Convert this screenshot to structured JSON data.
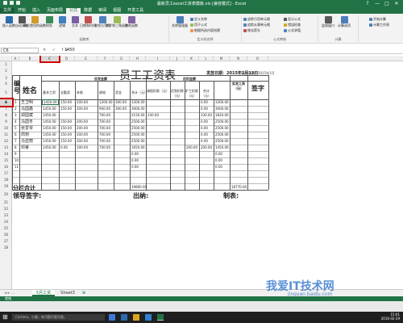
{
  "app": {
    "title": "最新员工excel工资表模板.xls [兼容模式] - Excel",
    "window_controls": [
      "?",
      "—",
      "□",
      "✕"
    ]
  },
  "tabs": [
    "文件",
    "开始",
    "插入",
    "页面布局",
    "公式",
    "数据",
    "审阅",
    "视图",
    "开发工具"
  ],
  "active_tab": "公式",
  "ribbon": {
    "buttons": [
      {
        "icon": "fx-icon",
        "label": "插入函数",
        "color": "#2b6cb0"
      },
      {
        "icon": "autosum-icon",
        "label": "自动求和",
        "color": "#555555"
      },
      {
        "icon": "recent-icon",
        "label": "最近使用的函数",
        "color": "#d39b2b"
      },
      {
        "icon": "finance-icon",
        "label": "财务",
        "color": "#3a8a5a"
      },
      {
        "icon": "logic-icon",
        "label": "逻辑",
        "color": "#3f7fc4"
      },
      {
        "icon": "text-icon",
        "label": "文本",
        "color": "#7b5ea7"
      },
      {
        "icon": "datetime-icon",
        "label": "日期和时间",
        "color": "#c0504d"
      },
      {
        "icon": "lookup-icon",
        "label": "查找与引用",
        "color": "#4f81bd"
      },
      {
        "icon": "math-icon",
        "label": "数学和三角函数",
        "color": "#9bbb59"
      },
      {
        "icon": "more-icon",
        "label": "其他函数",
        "color": "#8064a2"
      },
      {
        "icon": "name-manager-icon",
        "label": "名称管理器",
        "color": "#4a7ebb"
      },
      {
        "icon": "watch-icon",
        "label": "监视窗口",
        "color": "#5a5a5a"
      },
      {
        "icon": "calc-options-icon",
        "label": "计算选项",
        "color": "#4a7ebb"
      }
    ],
    "small": [
      "定义名称",
      "用于公式",
      "根据所选内容创建",
      "追踪引用单元格",
      "追踪从属单元格",
      "移去箭头",
      "显示公式",
      "错误检查",
      "公式求值",
      "开始计算",
      "计算工作表"
    ],
    "groups": [
      "函数库",
      "定义的名称",
      "公式审核",
      "计算"
    ]
  },
  "formula_bar": {
    "name_box": "C6",
    "fx": "✕  ✓  fx",
    "value": "1450"
  },
  "columns": [
    "A",
    "B",
    "C",
    "D",
    "E",
    "F",
    "G",
    "H",
    "I",
    "J",
    "K",
    "L",
    "M",
    "N",
    "O"
  ],
  "rows": [
    "1",
    "2",
    "3",
    "4",
    "5",
    "6",
    "7",
    "8",
    "9",
    "10",
    "11",
    "12",
    "13",
    "14",
    "15",
    "16",
    "17",
    "18",
    "19",
    "20",
    "21",
    "22",
    "23",
    "24",
    "25",
    "26",
    "27",
    "28"
  ],
  "sheet": {
    "title": "员工工资表",
    "issue_date": "发放日期：2015年2月12日",
    "period": "所属日期：2015年1月",
    "header_no": "编号",
    "header_name": "姓名",
    "header_payable": "应发金额",
    "header_deduct": "应扣金额",
    "header_actual": "实发工资（元）",
    "header_sign": "签字",
    "sub_payable": [
      "基本工资",
      "全勤奖",
      "补助",
      "绩效",
      "奖金",
      "合计（元）"
    ],
    "sub_deduct": [
      "请假扣款（元）",
      "迟到扣款（元）",
      "旷工扣款（元）",
      "合计（元）"
    ],
    "rows": [
      {
        "no": "1",
        "name": "王卫明",
        "v": [
          "1450.00",
          "150.00",
          "200.00",
          "1200.00",
          "300.00",
          "3300.00",
          "",
          "",
          "",
          "0.00",
          "3300.00"
        ]
      },
      {
        "no": "2",
        "name": "马国鑫",
        "v": [
          "1450.00",
          "150.00",
          "200.00",
          "900.00",
          "300.00",
          "3000.00",
          "",
          "",
          "",
          "0.00",
          "3000.00"
        ]
      },
      {
        "no": "3",
        "name": "郑国斌",
        "v": [
          "1450.00",
          "",
          "",
          "700.00",
          "",
          "2150.00",
          "330.00",
          "",
          "",
          "330.00",
          "1820.00"
        ]
      },
      {
        "no": "4",
        "name": "马国冬",
        "v": [
          "1450.00",
          "150.00",
          "200.00",
          "700.00",
          "",
          "2500.00",
          "",
          "",
          "",
          "0.00",
          "2500.00"
        ]
      },
      {
        "no": "5",
        "name": "张爱琴",
        "v": [
          "1450.00",
          "150.00",
          "200.00",
          "700.00",
          "",
          "2500.00",
          "",
          "",
          "",
          "0.00",
          "2500.00"
        ]
      },
      {
        "no": "6",
        "name": "周玥",
        "v": [
          "1450.00",
          "150.00",
          "200.00",
          "700.00",
          "",
          "2500.00",
          "",
          "",
          "",
          "0.00",
          "2500.00"
        ]
      },
      {
        "no": "7",
        "name": "马亚丽",
        "v": [
          "1450.00",
          "150.00",
          "200.00",
          "700.00",
          "",
          "2500.00",
          "",
          "",
          "",
          "0.00",
          "2500.00"
        ]
      },
      {
        "no": "8",
        "name": "邓睿",
        "v": [
          "1450.00",
          "0.00",
          "100.00",
          "700.00",
          "",
          "1650.00",
          "",
          "",
          "200.00",
          "200.00",
          "1450.00"
        ]
      },
      {
        "no": "9",
        "name": "",
        "v": [
          "",
          "",
          "",
          "",
          "",
          "0.00",
          "",
          "",
          "",
          "",
          "0.00"
        ]
      },
      {
        "no": "10",
        "name": "",
        "v": [
          "",
          "",
          "",
          "",
          "",
          "0.00",
          "",
          "",
          "",
          "",
          "0.00"
        ]
      },
      {
        "no": "11",
        "name": "",
        "v": [
          "",
          "",
          "",
          "",
          "",
          "0.00",
          "",
          "",
          "",
          "",
          "0.00"
        ]
      }
    ],
    "subtotal_label": "分栏合计",
    "subtotal_pay": "19800.00",
    "subtotal_actual": "18770.00",
    "sign_leader": "领导签字:",
    "sign_cashier": "出纳:",
    "sign_maker": "制表:"
  },
  "sheet_tabs": [
    "5月工资",
    "Sheet3"
  ],
  "status_text": "就绪",
  "watermark": {
    "text": "我爱IT技术网",
    "url": "jingyan.baidu.com"
  },
  "taskbar": {
    "search": "Cortana，小娜。有问题尽管问我。",
    "time": "15:01",
    "date": "2016-02-29"
  }
}
